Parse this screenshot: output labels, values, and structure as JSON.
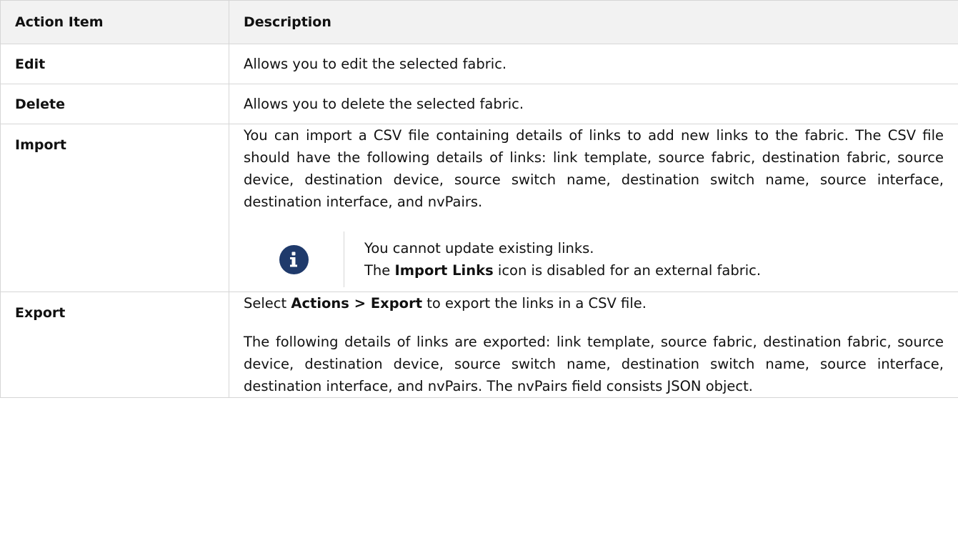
{
  "table": {
    "headers": [
      "Action Item",
      "Description"
    ],
    "rows": {
      "edit": {
        "item": "Edit",
        "desc": "Allows you to edit the selected fabric."
      },
      "delete": {
        "item": "Delete",
        "desc": "Allows you to delete the selected fabric."
      },
      "import": {
        "item": "Import",
        "desc": "You can import a CSV file containing details of links to add new links to the fabric. The CSV file should have the following details of links: link template, source fabric, destination fabric, source device, destination device, source switch name, destination switch name, source interface, destination interface, and nvPairs.",
        "note_line1": "You cannot update existing links.",
        "note_line2_prefix": "The ",
        "note_line2_bold": "Import Links",
        "note_line2_suffix": " icon is disabled for an external fabric."
      },
      "export": {
        "item": "Export",
        "p1_prefix": "Select ",
        "p1_bold": "Actions > Export",
        "p1_suffix": " to export the links in a CSV file.",
        "p2": "The following details of links are exported: link template, source fabric, destination fabric, source device, destination device, source switch name, destination switch name, source interface, destination interface, and nvPairs. The nvPairs field consists JSON object."
      }
    }
  },
  "colors": {
    "header_bg": "#f2f2f2",
    "border": "#d6d6d6",
    "info_icon_bg": "#1f3a6b"
  },
  "icons": {
    "note": "info-icon"
  }
}
